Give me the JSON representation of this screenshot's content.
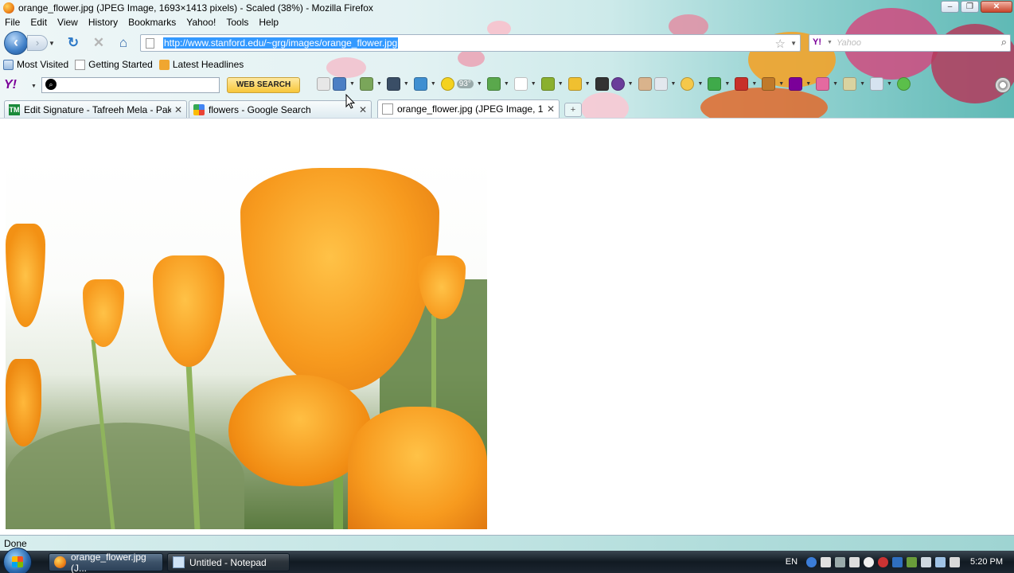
{
  "window": {
    "title": "orange_flower.jpg (JPEG Image, 1693×1413 pixels) - Scaled (38%) - Mozilla Firefox",
    "minimize": "–",
    "restore": "❐",
    "close": "✕"
  },
  "menu": {
    "items": [
      "File",
      "Edit",
      "View",
      "History",
      "Bookmarks",
      "Yahoo!",
      "Tools",
      "Help"
    ]
  },
  "nav": {
    "url": "http://www.stanford.edu/~grg/images/orange_flower.jpg",
    "search_placeholder": "Yahoo"
  },
  "bookmarks": {
    "items": [
      "Most Visited",
      "Getting Started",
      "Latest Headlines"
    ]
  },
  "yahoo_toolbar": {
    "search_button": "WEB SEARCH",
    "weather": "93°"
  },
  "tabs": [
    {
      "label": "Edit Signature - Tafreeh Mela - Paki...",
      "icon": "TM"
    },
    {
      "label": "flowers - Google Search"
    },
    {
      "label": "orange_flower.jpg (JPEG Image, 1...",
      "active": true
    }
  ],
  "status": {
    "text": "Done"
  },
  "taskbar": {
    "items": [
      "orange_flower.jpg (J...",
      "Untitled - Notepad"
    ],
    "lang": "EN",
    "clock": "5:20 PM"
  },
  "colors": {
    "url_selection": "#3399ff",
    "tulip_orange": "#f79a1e",
    "yahoo_purple": "#7b0099"
  }
}
